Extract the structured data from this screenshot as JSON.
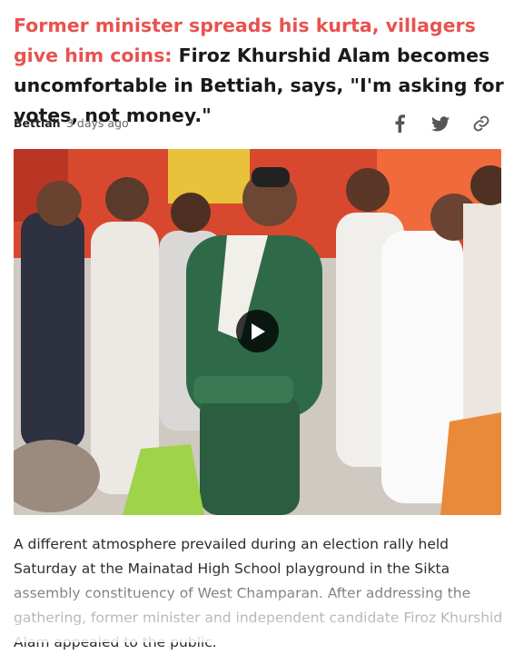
{
  "article": {
    "kicker": "Former minister spreads his kurta, villagers give him coins:",
    "title": "Firoz Khurshid Alam becomes uncomfortable in Bettiah, says, \"I'm asking for votes, not money.\"",
    "location": "Bettiah",
    "time": "3 days ago",
    "body": "A different atmosphere prevailed during an election rally held Saturday at the Mainatad High School playground in the Sikta assembly constituency of West Champaran. After addressing the gathering, former minister and independent candidate Firoz Khurshid Alam appealed to the public."
  },
  "share": {
    "icons": [
      "facebook-icon",
      "twitter-icon",
      "link-icon"
    ]
  },
  "media": {
    "type": "video",
    "control": "play-icon"
  },
  "colors": {
    "kicker": "#e8524f",
    "text": "#1a1a1a",
    "meta": "#666666",
    "icon": "#555555"
  }
}
